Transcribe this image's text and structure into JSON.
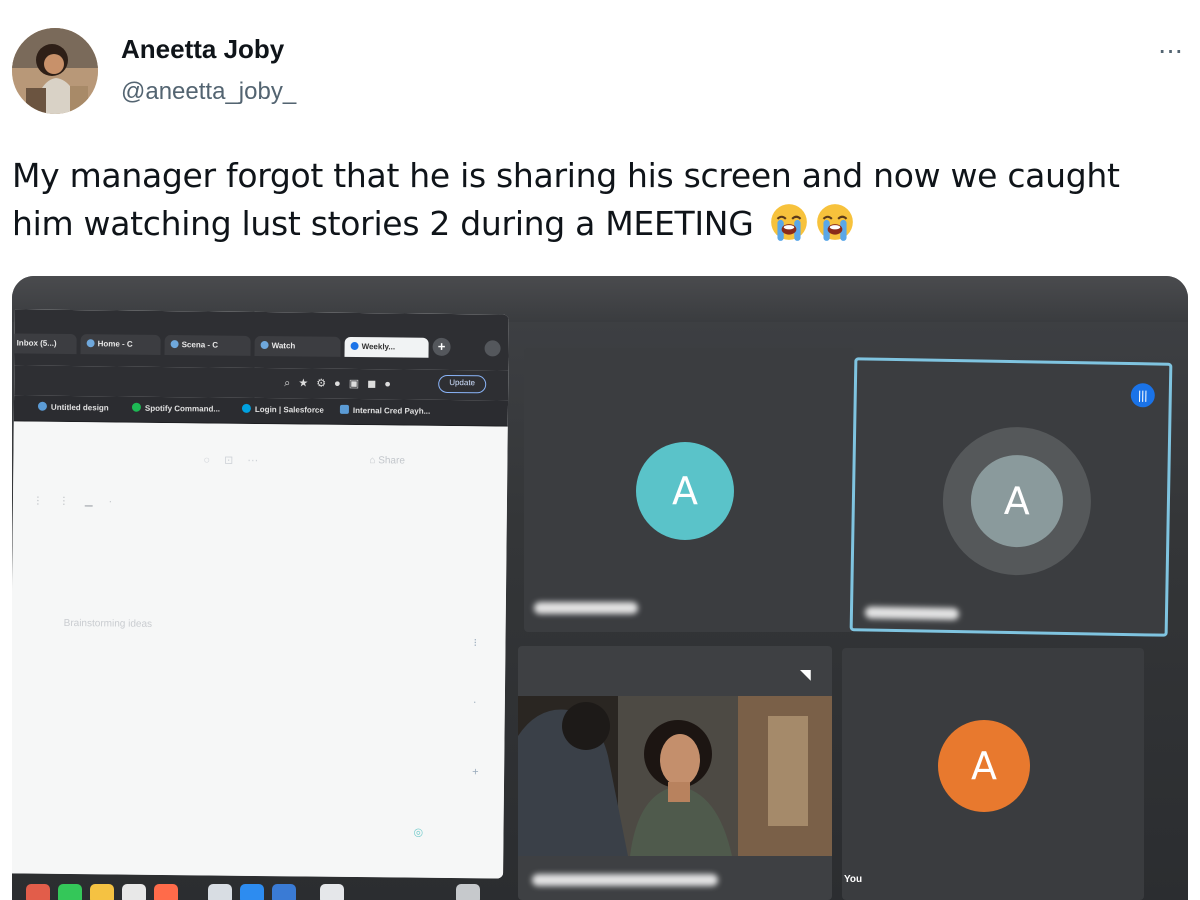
{
  "tweet": {
    "display_name": "Aneetta Joby",
    "handle": "@aneetta_joby_",
    "more_label": "···",
    "text": "My manager forgot that he is sharing his screen and now we caught him watching lust stories 2 during a MEETING",
    "emojis": [
      "loudly-crying-face-icon",
      "loudly-crying-face-icon"
    ]
  },
  "photo": {
    "browser": {
      "tabs": [
        {
          "label": "Inbox (5...)",
          "active": false
        },
        {
          "label": "Home - C",
          "active": false
        },
        {
          "label": "Scena - C",
          "active": false
        },
        {
          "label": "Watch",
          "active": false
        },
        {
          "label": "Weekly...",
          "active": true
        }
      ],
      "new_tab_label": "+",
      "update_label": "Update",
      "bookmarks": [
        {
          "label": "Untitled design"
        },
        {
          "label": "Spotify Command..."
        },
        {
          "label": "Login | Salesforce"
        },
        {
          "label": "Internal Cred Payh..."
        }
      ],
      "share_label": "Share",
      "placeholder": "Brainstorming ideas"
    },
    "tiles": {
      "participant_1_initial": "A",
      "participant_2_initial": "A",
      "self_initial": "A",
      "self_label": "You"
    },
    "colors": {
      "avatar_teal": "#5ac3c9",
      "avatar_gray": "#8a9a9c",
      "avatar_orange": "#e8792e",
      "speaker_border": "#7fc4e0"
    }
  }
}
